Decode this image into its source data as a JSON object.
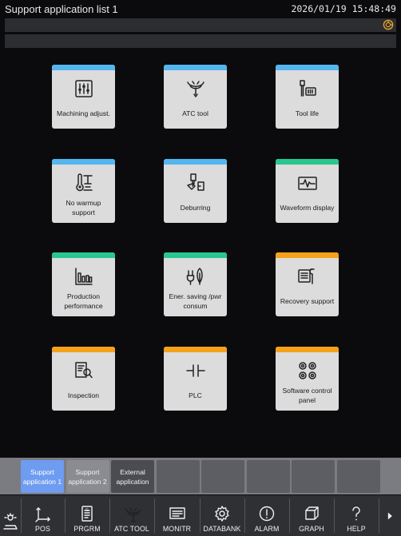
{
  "header": {
    "title": "Support application list 1",
    "datetime": "2026/01/19  15:48:49"
  },
  "message_icon": "alarm-indicator-icon",
  "colors": {
    "blue": "#55b6ef",
    "green": "#27c78e",
    "orange": "#f5a21a",
    "active_tab": "#6e9cf0"
  },
  "cards": [
    {
      "label": "Machining adjust.",
      "strip": "blue",
      "icon": "sliders-icon"
    },
    {
      "label": "ATC tool",
      "strip": "blue",
      "icon": "atc-tool-icon"
    },
    {
      "label": "Tool life",
      "strip": "blue",
      "icon": "tool-life-icon"
    },
    {
      "label": "No warmup support",
      "strip": "blue",
      "icon": "thermometer-icon"
    },
    {
      "label": "Deburring",
      "strip": "blue",
      "icon": "deburring-icon"
    },
    {
      "label": "Waveform display",
      "strip": "green",
      "icon": "waveform-icon"
    },
    {
      "label": "Production performance",
      "strip": "green",
      "icon": "bar-chart-icon"
    },
    {
      "label": "Ener. saving /pwr consum",
      "strip": "green",
      "icon": "energy-icon"
    },
    {
      "label": "Recovery support",
      "strip": "orange",
      "icon": "recovery-icon"
    },
    {
      "label": "Inspection",
      "strip": "orange",
      "icon": "inspection-icon"
    },
    {
      "label": "PLC",
      "strip": "orange",
      "icon": "plc-icon"
    },
    {
      "label": "Software control panel",
      "strip": "orange",
      "icon": "control-panel-icon"
    }
  ],
  "app_tabs": [
    {
      "label": "Support application 1",
      "state": "active"
    },
    {
      "label": "Support application 2",
      "state": "normal"
    },
    {
      "label": "External application",
      "state": "dark"
    },
    {
      "label": "",
      "state": "empty"
    },
    {
      "label": "",
      "state": "empty"
    },
    {
      "label": "",
      "state": "empty"
    },
    {
      "label": "",
      "state": "empty"
    },
    {
      "label": "",
      "state": "empty"
    }
  ],
  "function_keys": [
    {
      "label": "",
      "icon": "operator-icon"
    },
    {
      "label": "POS",
      "icon": "position-axes-icon"
    },
    {
      "label": "PRGRM",
      "icon": "program-icon"
    },
    {
      "label": "ATC TOOL",
      "icon": "atc-tool-icon"
    },
    {
      "label": "MONITR",
      "icon": "monitor-icon"
    },
    {
      "label": "DATABANK",
      "icon": "gear-icon"
    },
    {
      "label": "ALARM",
      "icon": "alarm-icon"
    },
    {
      "label": "GRAPH",
      "icon": "graph-cube-icon"
    },
    {
      "label": "HELP",
      "icon": "help-icon"
    },
    {
      "label": "",
      "icon": "next-arrow-icon"
    }
  ]
}
